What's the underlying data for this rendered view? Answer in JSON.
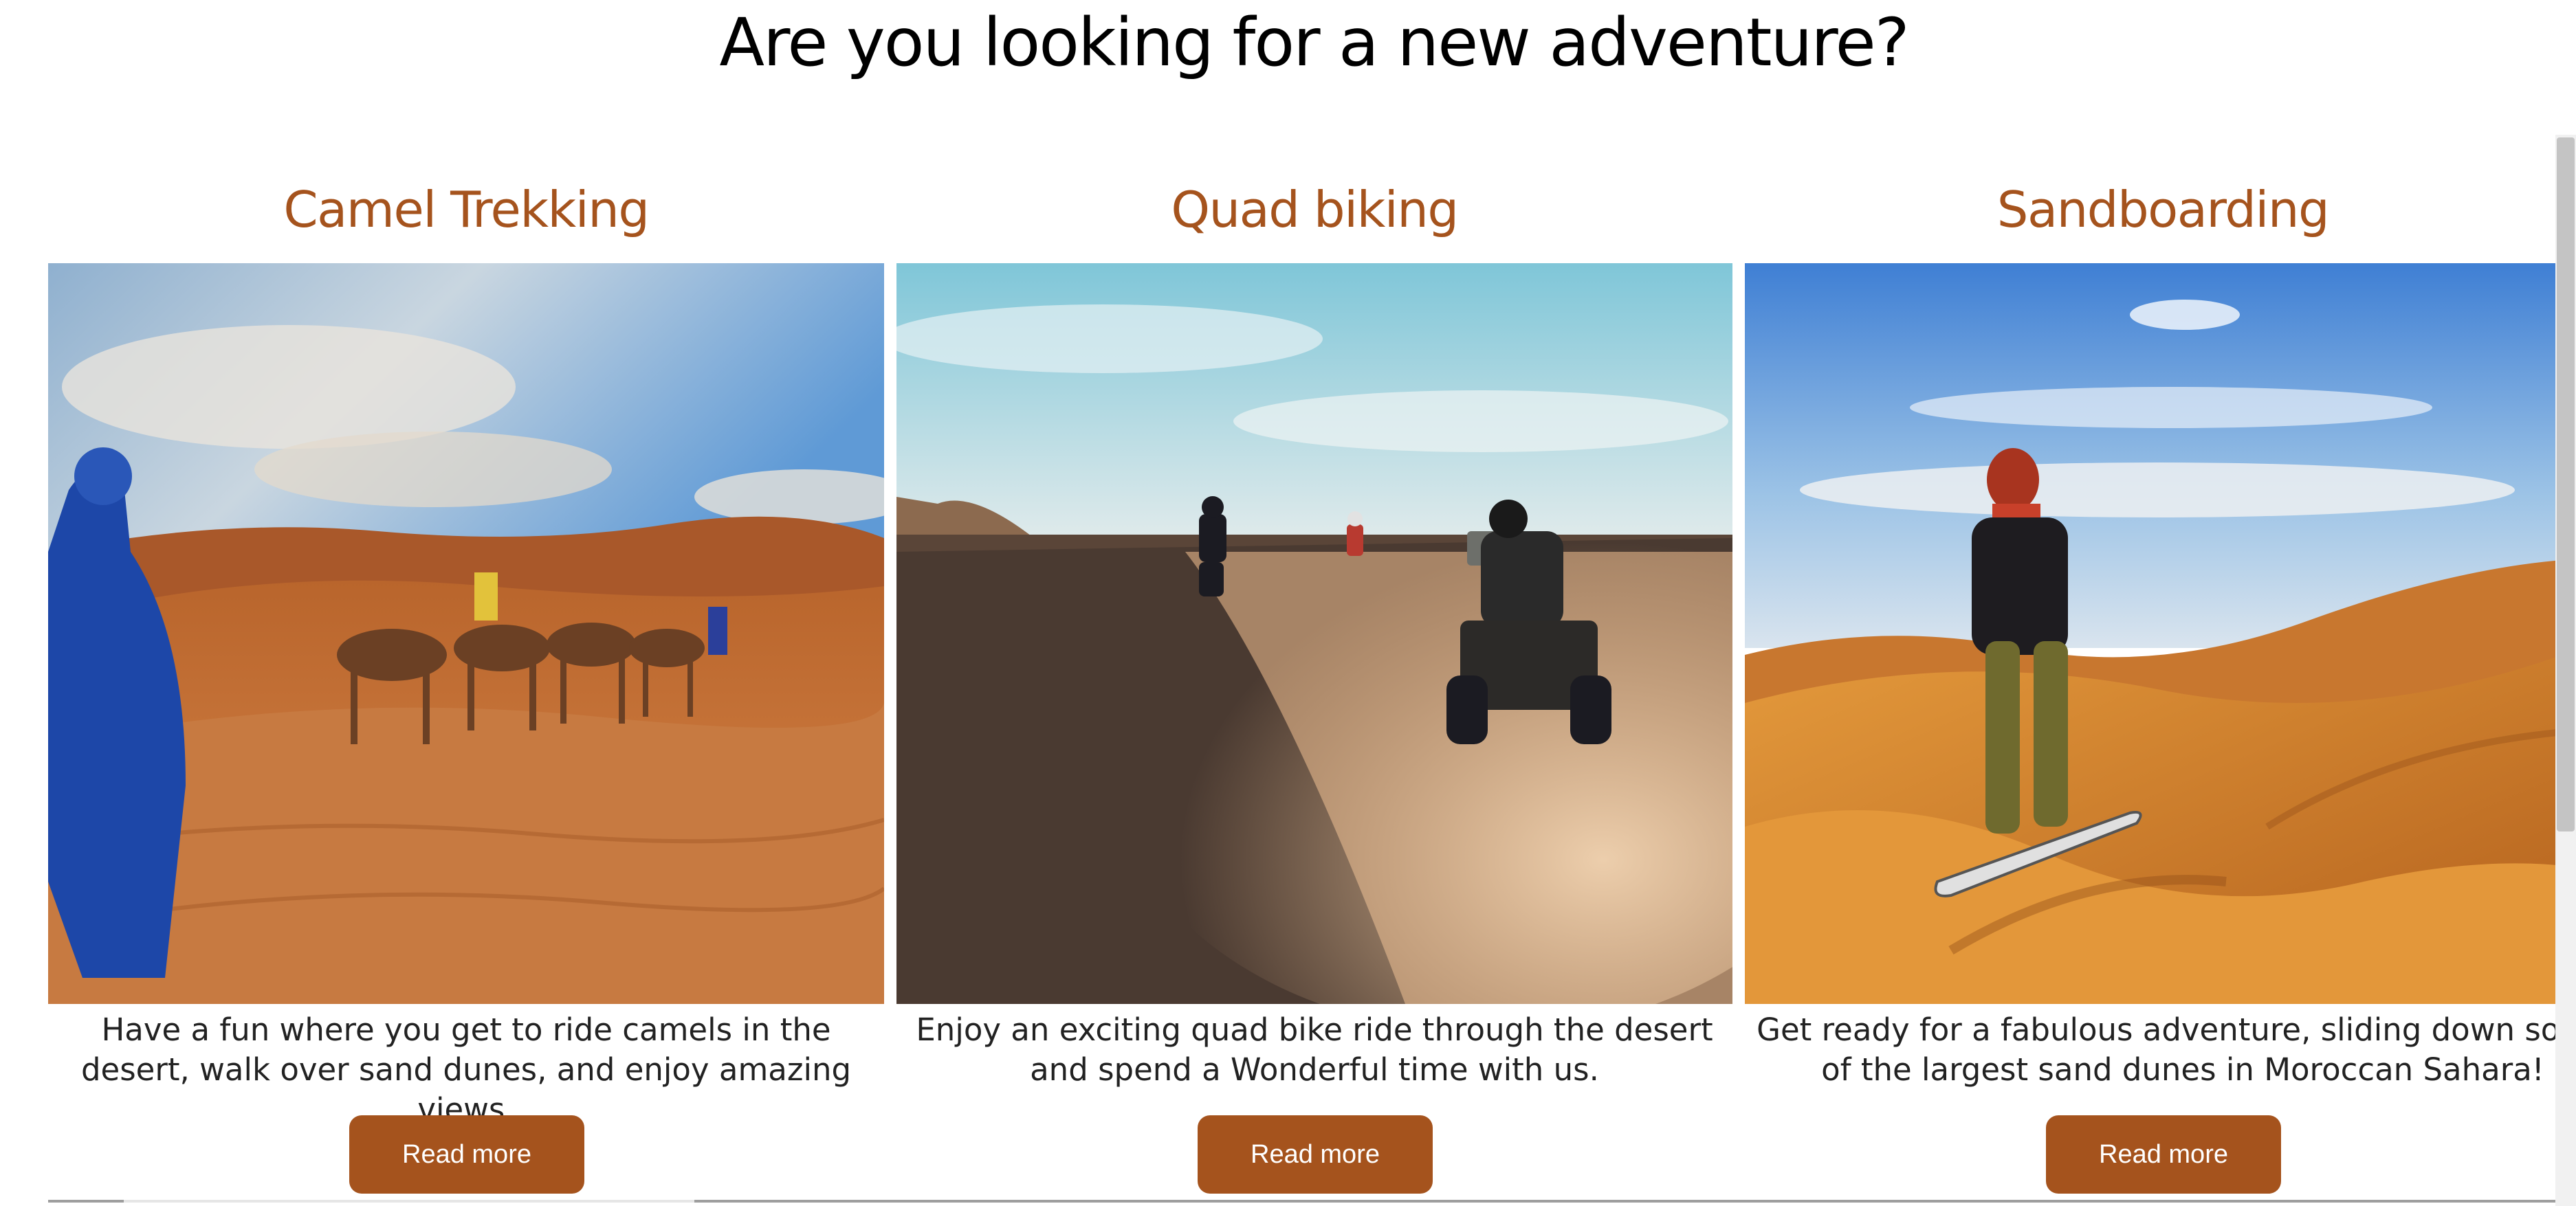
{
  "heading": "Are you looking for a new adventure?",
  "colors": {
    "accent": "#a5531d",
    "button_text": "#ffffff"
  },
  "cards": [
    {
      "title": "Camel Trekking",
      "description": "Have a fun where you get to ride camels in the desert, walk over sand dunes, and enjoy amazing views.",
      "button_label": "Read more",
      "image": "camel-caravan-desert-photo"
    },
    {
      "title": "Quad biking",
      "description": "Enjoy an exciting quad bike ride through the desert and spend a Wonderful time with us.",
      "button_label": "Read more",
      "image": "quad-bikes-dusty-track-photo"
    },
    {
      "title": "Sandboarding",
      "description": "Get ready for a fabulous adventure, sliding down some of the largest sand dunes in Moroccan Sahara!",
      "button_label": "Read more",
      "image": "sandboarder-on-dune-photo"
    }
  ]
}
